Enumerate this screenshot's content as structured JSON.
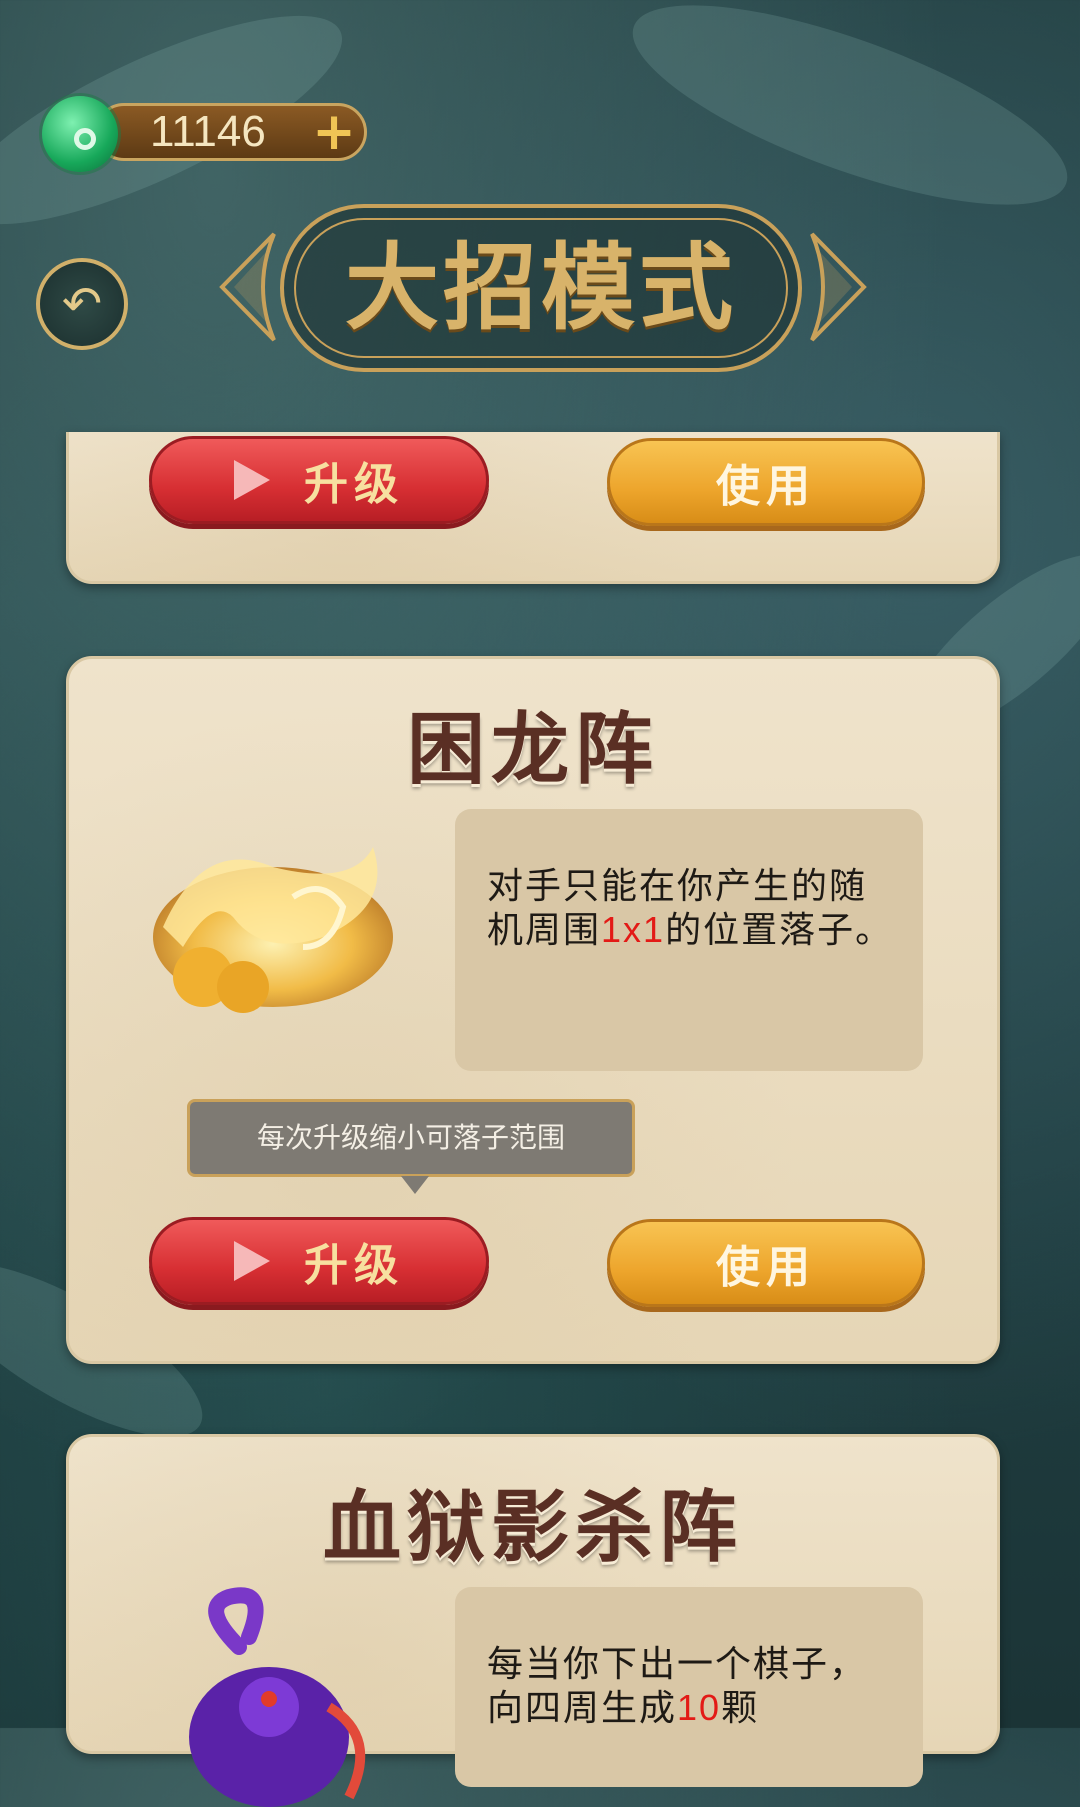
{
  "header": {
    "currency_value": "11146",
    "currency_add": "+",
    "title": "大招模式"
  },
  "cards": [
    {
      "upgrade_label": "升级",
      "use_label": "使用"
    },
    {
      "title": "困龙阵",
      "desc_pre": "对手只能在你产生的随机周围",
      "desc_highlight": "1x1",
      "desc_post": "的位置落子。",
      "tooltip": "每次升级缩小可落子范围",
      "upgrade_label": "升级",
      "use_label": "使用"
    },
    {
      "title": "血狱影杀阵",
      "desc_pre": "每当你下出一个棋子，向四周生成",
      "desc_highlight": "10",
      "desc_post": "颗"
    }
  ],
  "colors": {
    "upgrade_red": "#d72f33",
    "use_orange": "#eda52c",
    "title_gold": "#d8b36a",
    "highlight_red": "#e31a16"
  },
  "icons": {
    "back": "back-arrow-icon",
    "currency": "jade-icon",
    "play": "play-icon"
  }
}
